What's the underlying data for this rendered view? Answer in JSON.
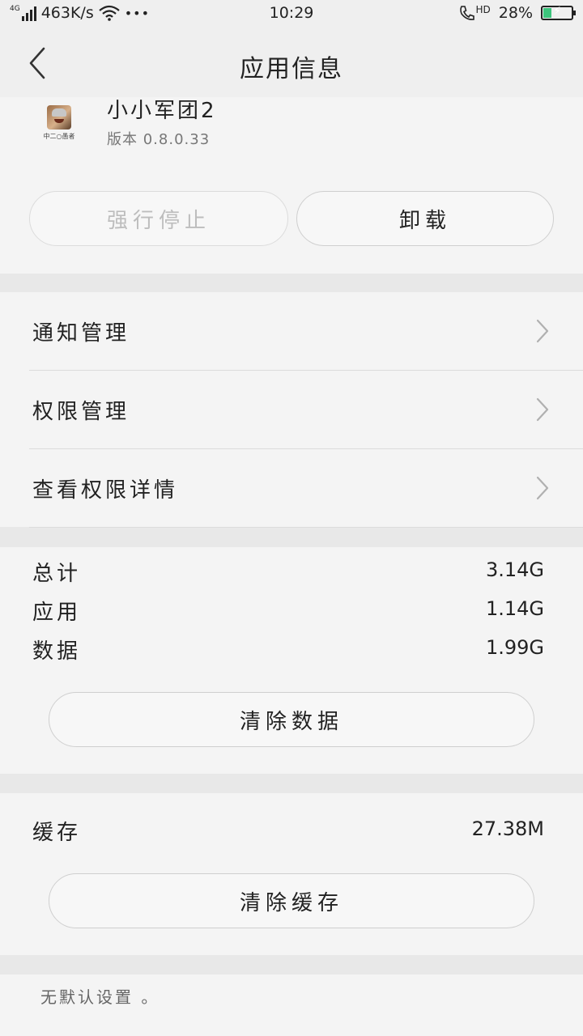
{
  "status_bar": {
    "network": "4G",
    "speed": "463K/s",
    "more": "•••",
    "time": "10:29",
    "hd": "HD",
    "battery_percent": "28%",
    "battery_level": 0.28,
    "battery_color": "#3cc47c"
  },
  "nav": {
    "title": "应用信息"
  },
  "app": {
    "name": "小小军团2",
    "version": "版本 0.8.0.33",
    "icon_text": "中二○愚者"
  },
  "actions": {
    "force_stop": "强行停止",
    "uninstall": "卸载"
  },
  "menu": {
    "items": [
      {
        "label": "通知管理"
      },
      {
        "label": "权限管理"
      },
      {
        "label": "查看权限详情"
      }
    ]
  },
  "storage": {
    "rows": [
      {
        "label": "总计",
        "value": "3.14G"
      },
      {
        "label": "应用",
        "value": "1.14G"
      },
      {
        "label": "数据",
        "value": "1.99G"
      }
    ],
    "clear_data": "清除数据"
  },
  "cache": {
    "label": "缓存",
    "value": "27.38M",
    "clear_cache": "清除缓存"
  },
  "defaults": {
    "note": "无默认设置 。"
  }
}
